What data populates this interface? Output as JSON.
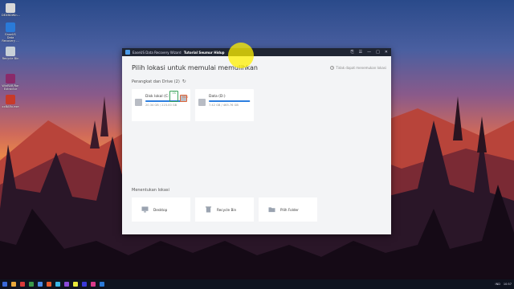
{
  "desktop": {
    "icons": [
      {
        "label": "DEXBDWin...",
        "color": "#d8d8d8"
      },
      {
        "label": "EaseUS Data Recovery ...",
        "color": "#2a7ad8"
      },
      {
        "label": "Recycle Bin",
        "color": "#c8d0d8"
      },
      {
        "label": "WinRAR/Rar Extractor",
        "color": "#8a2a6a"
      },
      {
        "label": "xxBARx.exe",
        "color": "#c83a2a"
      }
    ]
  },
  "window": {
    "title": "EaseUS Data Recovery Wizard",
    "subtitle": "Tutorial Seumur Hidup",
    "controls": [
      "⎘",
      "☰",
      "—",
      "□",
      "✕"
    ]
  },
  "main": {
    "heading": "Pilih lokasi untuk memulai memulihkan",
    "help": "Tidak dapat menemukan lokasi",
    "drives_section": "Perangkat dan Drive (2)",
    "drives": [
      {
        "name": "Disk lokal (C:)",
        "size": "20.34 GB / 223.00 GB",
        "used_pct": 91,
        "badges": [
          "OS",
          "HDD"
        ]
      },
      {
        "name": "Data (D:)",
        "size": "7.42 GB / 465.76 GB",
        "used_pct": 98,
        "badges": []
      }
    ],
    "locations_section": "Menentukan lokasi",
    "locations": [
      {
        "name": "Desktop",
        "icon": "desktop-icon"
      },
      {
        "name": "Recycle Bin",
        "icon": "recycle-bin-icon"
      },
      {
        "name": "Pilih Folder",
        "icon": "folder-icon"
      }
    ]
  },
  "taskbar": {
    "apps": [
      "#3a6ad8",
      "#e8a83a",
      "#d83a3a",
      "#3a9a4a",
      "#4a8ae8",
      "#e85a2a",
      "#3ab8e8",
      "#8a4ad8",
      "#e8e83a",
      "#3a3ad8",
      "#d83a8a",
      "#2a7ad8"
    ],
    "clock": "10:57",
    "lang": "IND"
  },
  "colors": {
    "accent": "#2d7fe0",
    "titlebar": "#1f2533",
    "cursor_highlight": "#fff000"
  }
}
